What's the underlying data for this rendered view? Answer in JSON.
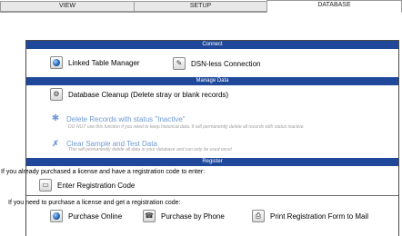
{
  "tabs": [
    {
      "label": "VIEW"
    },
    {
      "label": "SETUP"
    },
    {
      "label": "DATABASE"
    }
  ],
  "connect": {
    "header": "Connect",
    "linked_table_manager": "Linked Table Manager",
    "dsn_less_connection": "DSN-less Connection"
  },
  "manage": {
    "header": "Manage Data",
    "cleanup": "Database Cleanup (Delete stray or blank records)",
    "delete_inactive": "Delete Records with status \"Inactive\"",
    "delete_inactive_note": "DO NOT use this function if you need to keep historical data. It will permanently delete all records with status inactive.",
    "clear_sample": "Clear Sample and Test Data",
    "clear_sample_note": "This will permanently delete all data in your database and can only be used once!"
  },
  "register": {
    "header": "Register",
    "already_text": "If you already purchased a license and have a registration code to enter:",
    "enter_code": "Enter Registration Code",
    "need_text": "If you need to purchase a license and get a registration code:",
    "purchase_online": "Purchase Online",
    "purchase_phone": "Purchase by Phone",
    "print_form": "Print Registration Form to Mail"
  },
  "icons": {
    "linked_table_manager": "globe-icon",
    "dsn_less_connection": "database-pen-icon",
    "cleanup": "cleanup-icon",
    "delete_inactive": "delete-person-icon",
    "clear_sample": "clear-icon",
    "enter_code": "registration-card-icon",
    "purchase_online": "globe-icon",
    "purchase_phone": "phone-icon",
    "print_form": "printer-icon"
  },
  "colors": {
    "band": "#20489a",
    "disabled_text": "#6f9ad2"
  }
}
